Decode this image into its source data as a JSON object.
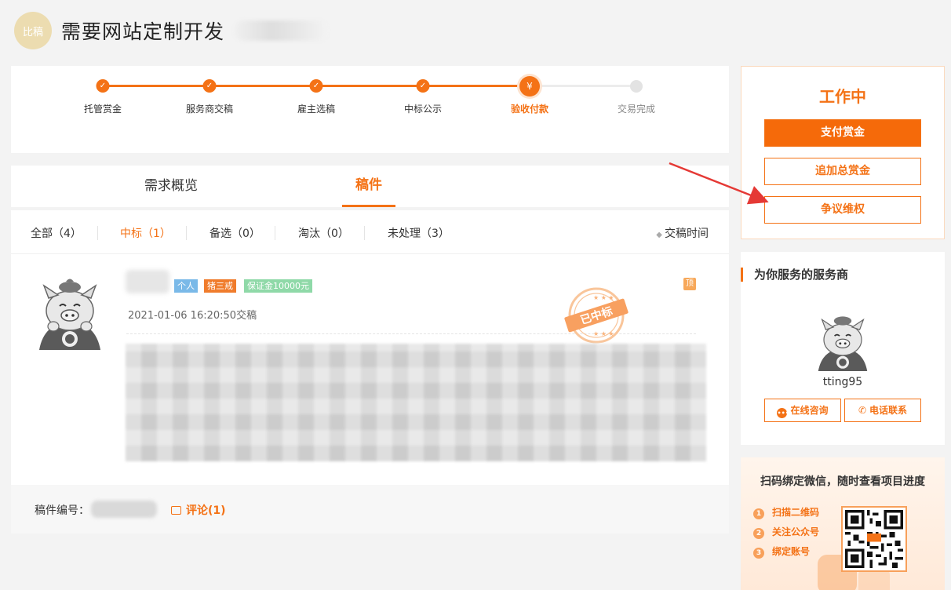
{
  "header": {
    "badge": "比稿",
    "title": "需要网站定制开发"
  },
  "progress": {
    "steps": [
      {
        "label": "托管赏金",
        "state": "done"
      },
      {
        "label": "服务商交稿",
        "state": "done"
      },
      {
        "label": "雇主选稿",
        "state": "done"
      },
      {
        "label": "中标公示",
        "state": "done"
      },
      {
        "label": "验收付款",
        "state": "current"
      },
      {
        "label": "交易完成",
        "state": "todo"
      }
    ]
  },
  "tabs": [
    {
      "label": "需求概览",
      "active": false
    },
    {
      "label": "稿件",
      "active": true
    }
  ],
  "filters": [
    {
      "label": "全部（4）"
    },
    {
      "label": "中标（1）"
    },
    {
      "label": "备选（0）"
    },
    {
      "label": "淘汰（0）"
    },
    {
      "label": "未处理（3）"
    }
  ],
  "active_filter": "中标（1）",
  "sort_label": "交稿时间",
  "submission": {
    "tags": [
      "个人",
      "猪三戒",
      "保证金10000元"
    ],
    "top_badge": "顶",
    "time": "2021-01-06 16:20:50交稿",
    "stamp": "已中标",
    "draft_no_label": "稿件编号：",
    "comment_label": "评论(1)"
  },
  "actions": {
    "status": "工作中",
    "pay_button": "支付赏金",
    "add_button": "追加总赏金",
    "dispute_button": "争议维权"
  },
  "service_provider": {
    "title": "为你服务的服务商",
    "name": "tting95",
    "consult_button": "在线咨询",
    "phone_button": "电话联系"
  },
  "wechat": {
    "title": "扫码绑定微信，随时查看项目进度",
    "steps": [
      "扫描二维码",
      "关注公众号",
      "绑定账号"
    ]
  },
  "colors": {
    "accent": "#f47216",
    "badge_bg": "#ecdcb0"
  }
}
